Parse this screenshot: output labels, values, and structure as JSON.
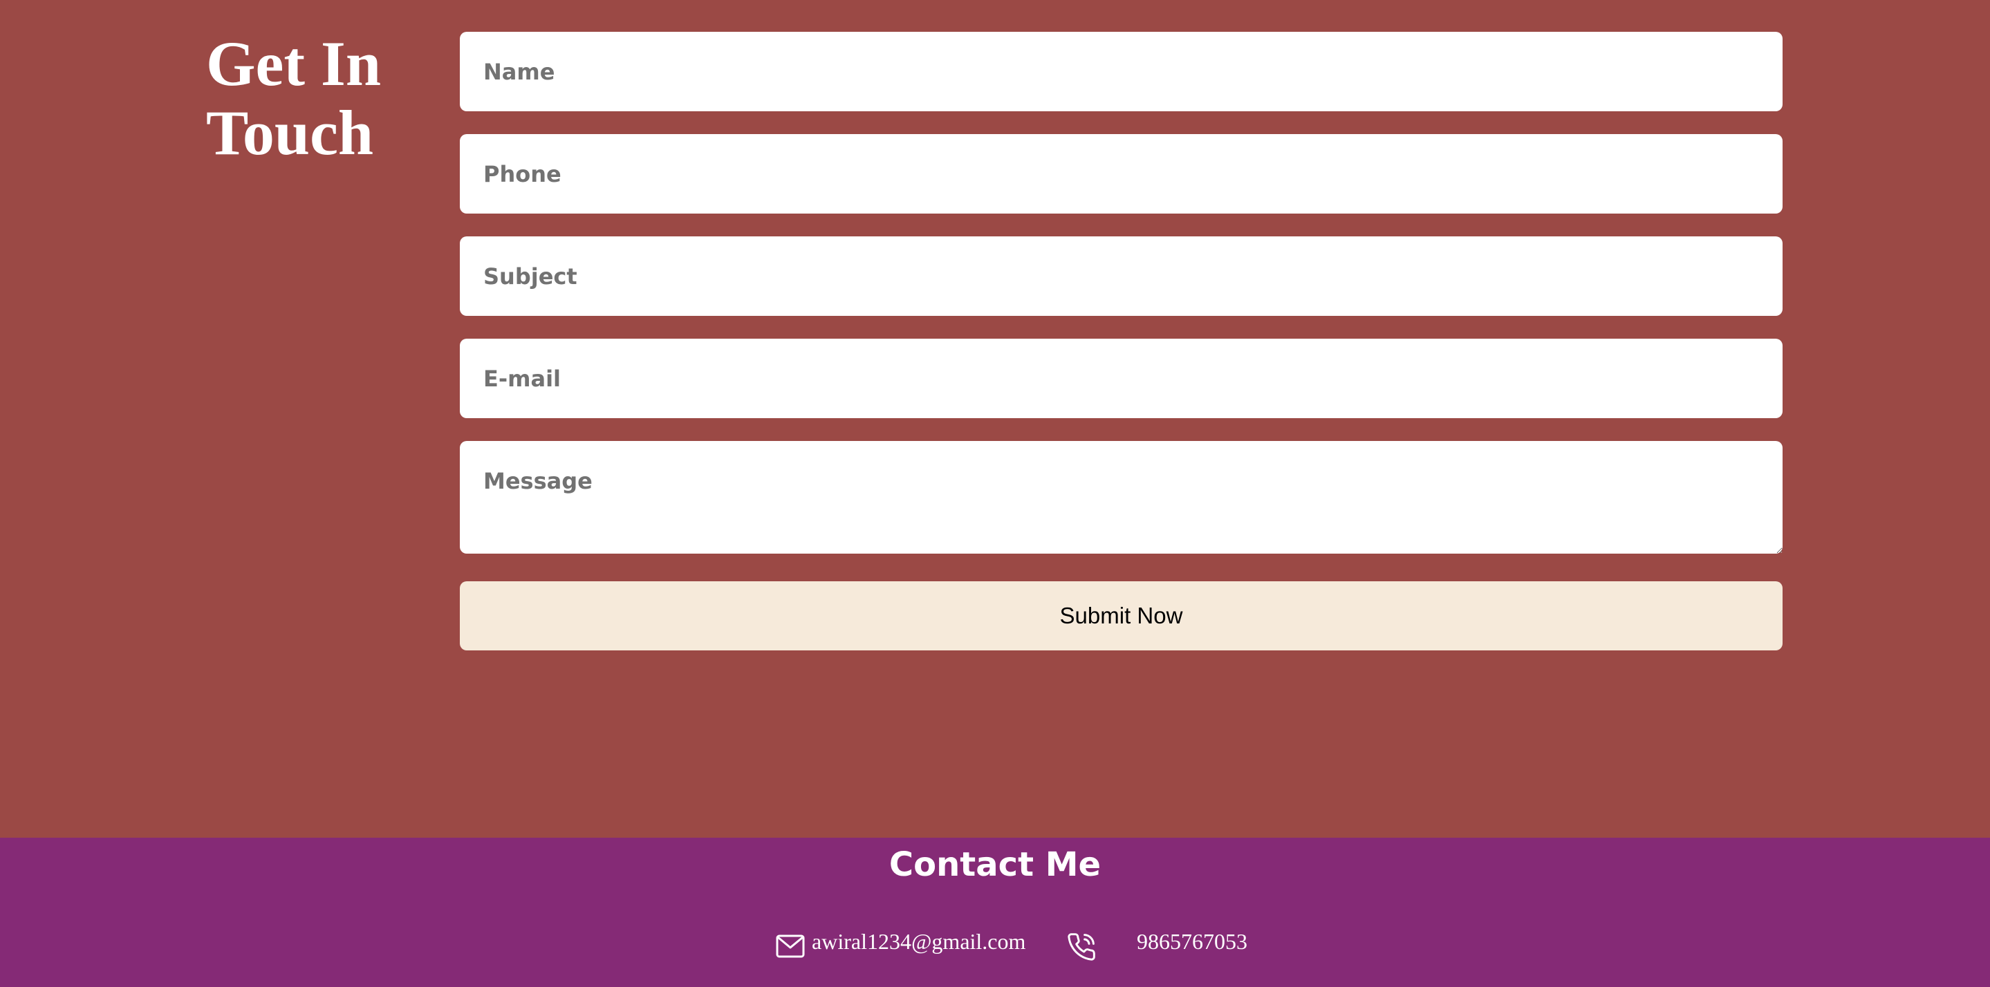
{
  "contact": {
    "heading": "Get In Touch",
    "fields": {
      "name_placeholder": "Name",
      "phone_placeholder": "Phone",
      "subject_placeholder": "Subject",
      "email_placeholder": "E-mail",
      "message_placeholder": "Message"
    },
    "submit_label": "Submit Now"
  },
  "footer": {
    "title": "Contact Me",
    "email": "awiral1234@gmail.com",
    "phone": "9865767053",
    "icons": {
      "email": "mail-icon",
      "phone": "phone-icon"
    }
  },
  "colors": {
    "section_background": "#9b4945",
    "footer_background": "#852a76",
    "submit_background": "#f6eada",
    "text_light": "#ffffff"
  }
}
